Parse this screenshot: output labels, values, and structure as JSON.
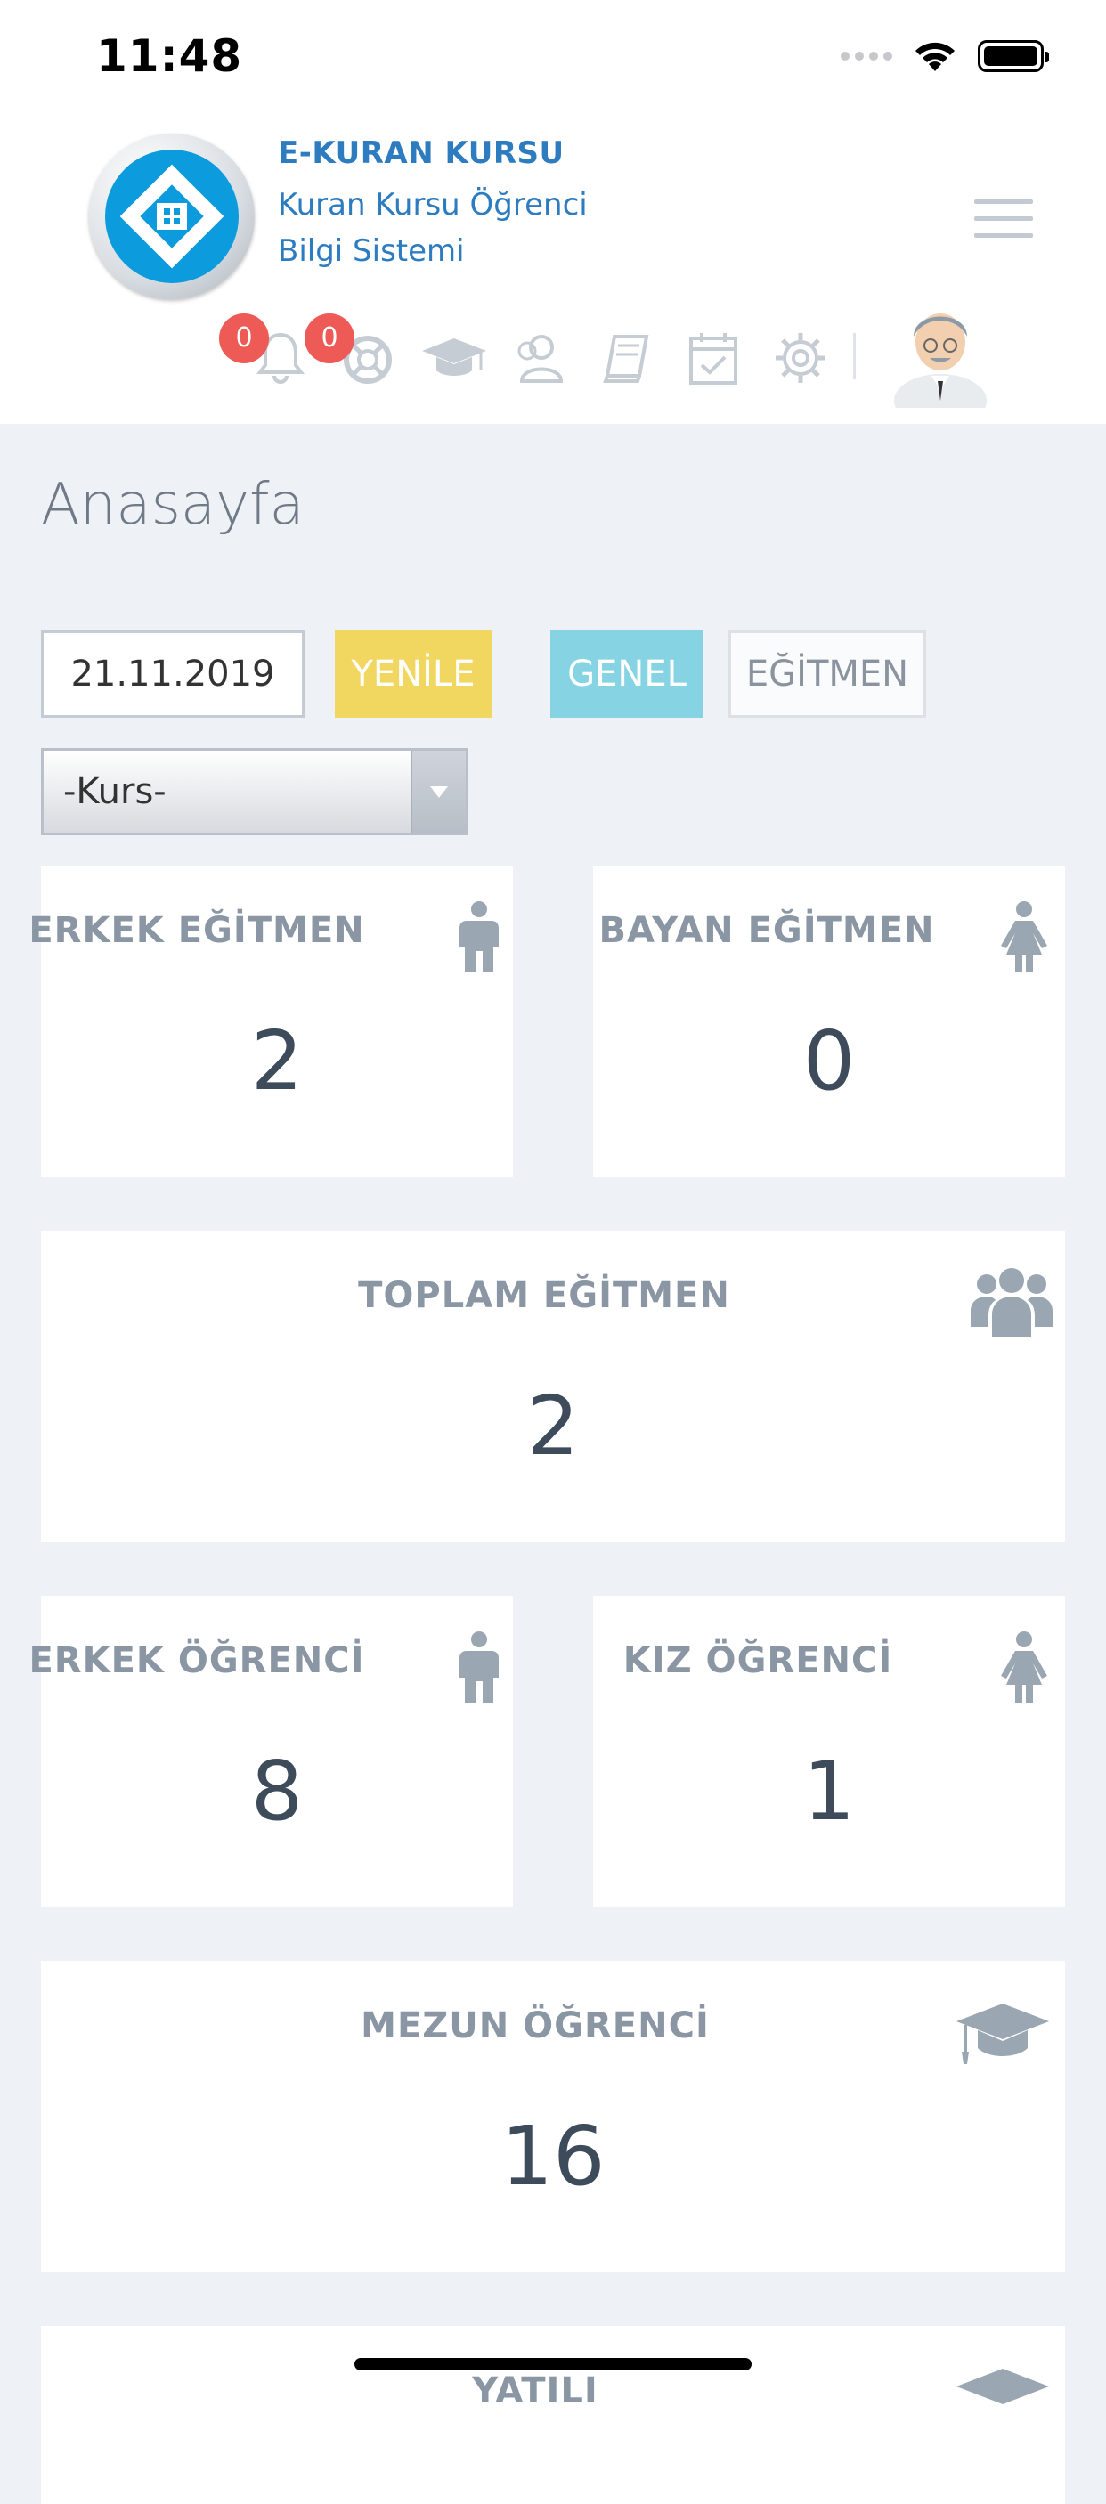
{
  "status_bar": {
    "time": "11:48"
  },
  "header": {
    "app_name": "E-KURAN KURSU",
    "app_subtitle": "Kuran Kursu Öğrenci Bilgi Sistemi",
    "notification_count": "0",
    "support_count": "0",
    "icons": [
      "bell-icon",
      "lifebuoy-icon",
      "graduation-cap-icon",
      "users-icon",
      "book-icon",
      "calendar-check-icon",
      "gear-icon"
    ]
  },
  "page": {
    "title": "Anasayfa"
  },
  "filters": {
    "date": "21.11.2019",
    "refresh_label": "YENİLE",
    "general_label": "GENEL",
    "instructor_label": "EĞİTMEN",
    "course_select": "-Kurs-"
  },
  "stats": {
    "male_instructor": {
      "label": "ERKEK EĞİTMEN",
      "value": "2"
    },
    "female_instructor": {
      "label": "BAYAN EĞİTMEN",
      "value": "0"
    },
    "total_instructor": {
      "label": "TOPLAM EĞİTMEN",
      "value": "2"
    },
    "male_student": {
      "label": "ERKEK ÖĞRENCİ",
      "value": "8"
    },
    "female_student": {
      "label": "KIZ ÖĞRENCİ",
      "value": "1"
    },
    "graduate_student": {
      "label": "MEZUN ÖĞRENCİ",
      "value": "16"
    },
    "boarding": {
      "label": "YATILI"
    }
  },
  "colors": {
    "brand_blue": "#2e7cc0",
    "refresh_yellow": "#f1d65f",
    "general_cyan": "#86d3e4",
    "badge_red": "#ee5a55",
    "page_bg": "#eef1f6"
  }
}
